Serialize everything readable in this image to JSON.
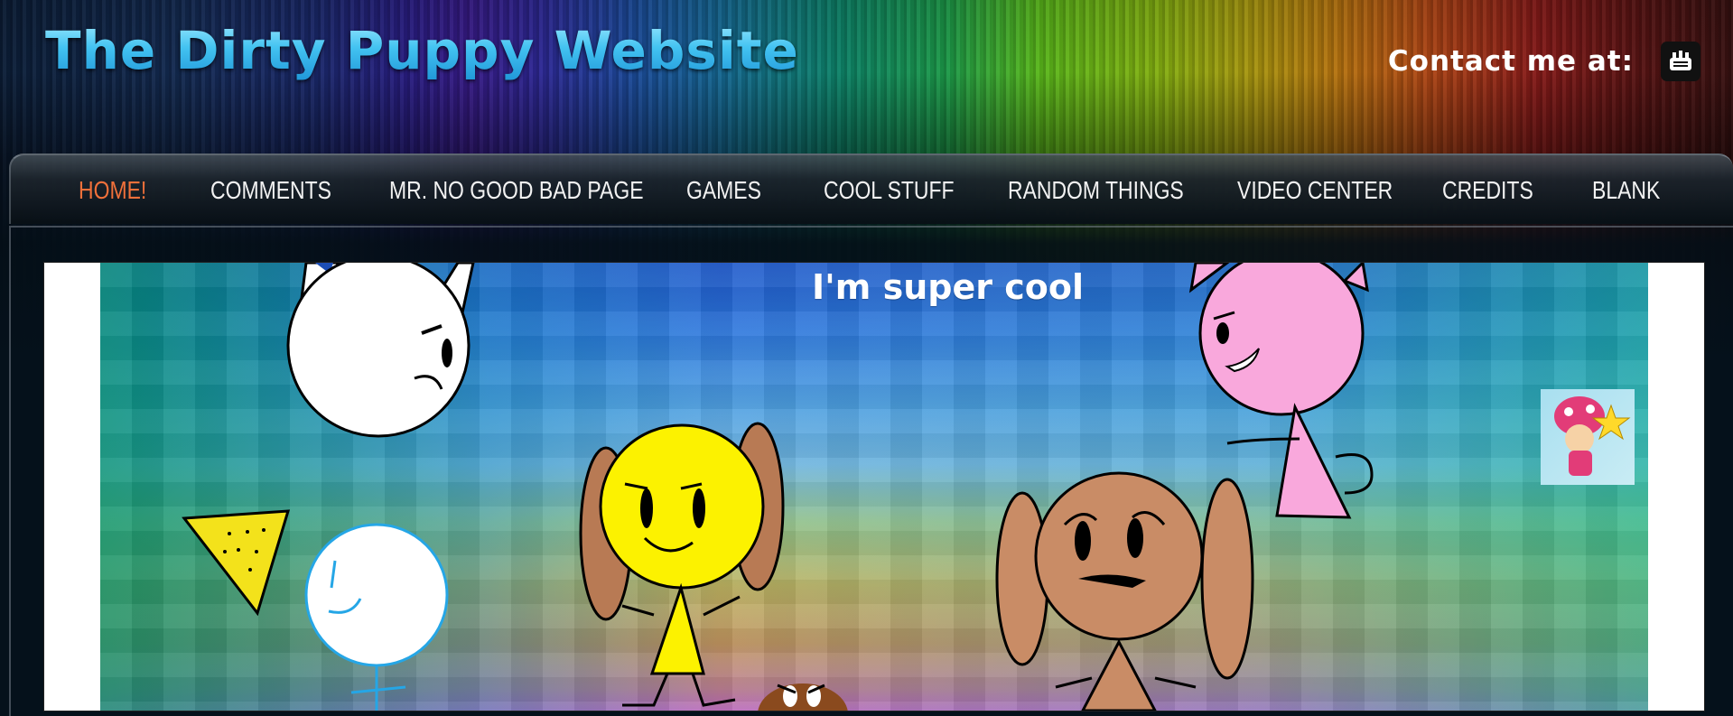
{
  "header": {
    "site_title": "The Dirty Puppy Website",
    "contact_label": "Contact me at:",
    "contact_icon": "email-badge-icon"
  },
  "nav": {
    "active_color": "#f0703a",
    "items": [
      {
        "label": "HOME!",
        "active": true
      },
      {
        "label": "COMMENTS",
        "active": false
      },
      {
        "label": "MR. NO GOOD BAD PAGE",
        "active": false
      },
      {
        "label": "GAMES",
        "active": false
      },
      {
        "label": "COOL STUFF",
        "active": false
      },
      {
        "label": "RANDOM THINGS",
        "active": false
      },
      {
        "label": "VIDEO CENTER",
        "active": false
      },
      {
        "label": "CREDITS",
        "active": false
      },
      {
        "label": "BLANK",
        "active": false
      }
    ]
  },
  "banner": {
    "caption": "I'm super cool"
  }
}
